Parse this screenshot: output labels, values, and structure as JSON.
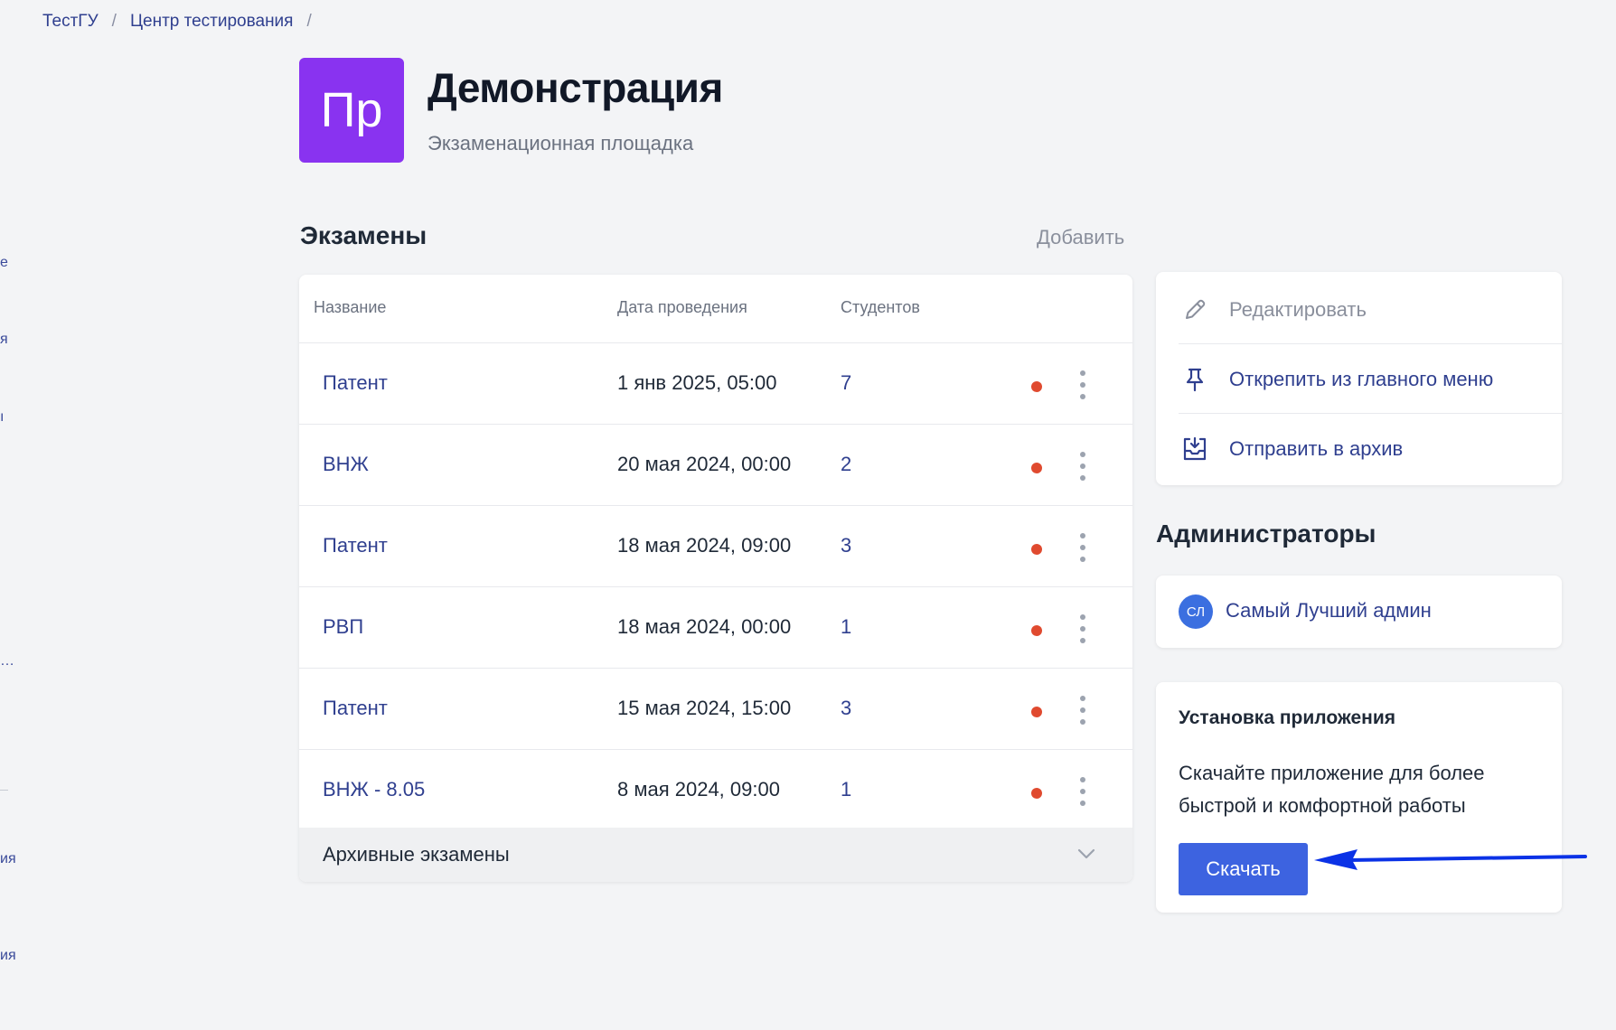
{
  "breadcrumb": {
    "items": [
      "ТестГУ",
      "Центр тестирования"
    ],
    "separator": "/"
  },
  "sidebar_fragments": [
    "е",
    "я",
    "ı",
    "…",
    "ия",
    "ия"
  ],
  "header": {
    "logo_text": "Пр",
    "title": "Демонстрация",
    "subtitle": "Экзаменационная площадка"
  },
  "exams": {
    "title": "Экзамены",
    "add_label": "Добавить",
    "columns": [
      "Название",
      "Дата проведения",
      "Студентов"
    ],
    "rows": [
      {
        "name": "Патент",
        "date": "1 янв 2025, 05:00",
        "students": "7"
      },
      {
        "name": "ВНЖ",
        "date": "20 мая 2024, 00:00",
        "students": "2"
      },
      {
        "name": "Патент",
        "date": "18 мая 2024, 09:00",
        "students": "3"
      },
      {
        "name": "РВП",
        "date": "18 мая 2024, 00:00",
        "students": "1"
      },
      {
        "name": "Патент",
        "date": "15 мая 2024, 15:00",
        "students": "3"
      },
      {
        "name": "ВНЖ - 8.05",
        "date": "8 мая 2024, 09:00",
        "students": "1"
      }
    ],
    "archive_label": "Архивные экзамены",
    "status_color": "#e04a2f"
  },
  "actions": {
    "edit": "Редактировать",
    "unpin": "Открепить из главного меню",
    "archive": "Отправить в архив"
  },
  "admins": {
    "title": "Администраторы",
    "items": [
      {
        "initials": "СЛ",
        "name": "Самый Лучший админ"
      }
    ]
  },
  "install": {
    "title": "Установка приложения",
    "text": "Скачайте приложение для более быстрой и комфортной работы",
    "button": "Скачать"
  },
  "colors": {
    "accent": "#3d63e0",
    "logo": "#8933f0",
    "link": "#2f3f8f",
    "annotation_arrow": "#0b32e6"
  }
}
